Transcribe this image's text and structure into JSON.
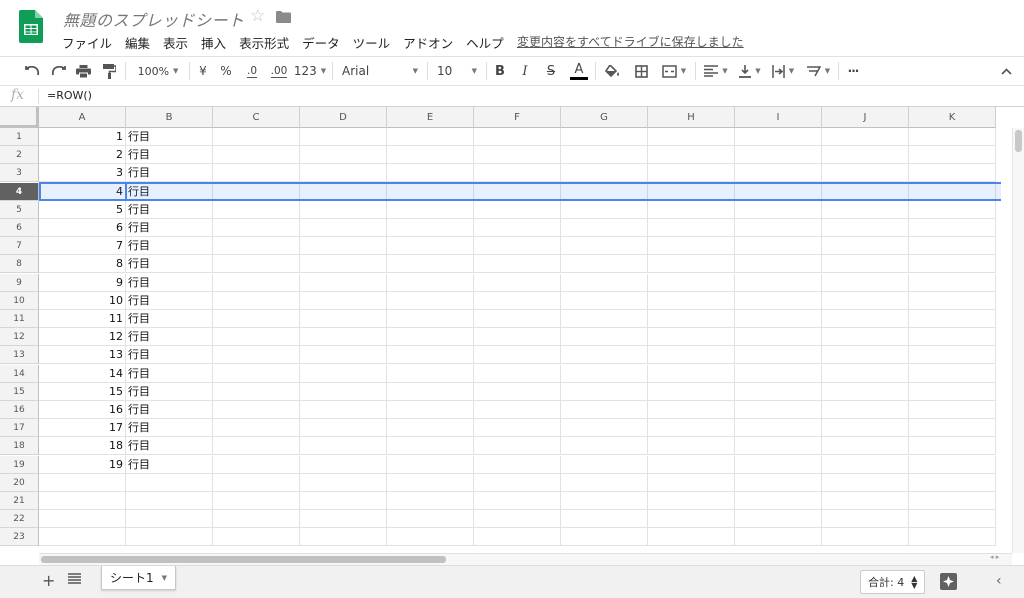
{
  "header": {
    "title": "無題のスプレッドシート",
    "save_status": "変更内容をすべてドライブに保存しました",
    "menu": [
      "ファイル",
      "編集",
      "表示",
      "挿入",
      "表示形式",
      "データ",
      "ツール",
      "アドオン",
      "ヘルプ"
    ]
  },
  "toolbar": {
    "zoom": "100%",
    "currency": "¥",
    "percent": "%",
    "decrease_decimal": ".0",
    "increase_decimal": ".00",
    "more_formats": "123",
    "font": "Arial",
    "font_size": "10",
    "bold": "B",
    "italic": "I",
    "strikethrough": "S",
    "text_color": "A",
    "more": "···"
  },
  "formula_bar": {
    "fx": "fx",
    "value": "=ROW()"
  },
  "grid": {
    "columns": [
      "A",
      "B",
      "C",
      "D",
      "E",
      "F",
      "G",
      "H",
      "I",
      "J",
      "K"
    ],
    "row_numbers": [
      "1",
      "2",
      "3",
      "4",
      "5",
      "6",
      "7",
      "8",
      "9",
      "10",
      "11",
      "12",
      "13",
      "14",
      "15",
      "16",
      "17",
      "18",
      "19",
      "20",
      "21",
      "22",
      "23"
    ],
    "selected_row": 4,
    "rows": [
      {
        "a": "1",
        "b": "行目"
      },
      {
        "a": "2",
        "b": "行目"
      },
      {
        "a": "3",
        "b": "行目"
      },
      {
        "a": "4",
        "b": "行目"
      },
      {
        "a": "5",
        "b": "行目"
      },
      {
        "a": "6",
        "b": "行目"
      },
      {
        "a": "7",
        "b": "行目"
      },
      {
        "a": "8",
        "b": "行目"
      },
      {
        "a": "9",
        "b": "行目"
      },
      {
        "a": "10",
        "b": "行目"
      },
      {
        "a": "11",
        "b": "行目"
      },
      {
        "a": "12",
        "b": "行目"
      },
      {
        "a": "13",
        "b": "行目"
      },
      {
        "a": "14",
        "b": "行目"
      },
      {
        "a": "15",
        "b": "行目"
      },
      {
        "a": "16",
        "b": "行目"
      },
      {
        "a": "17",
        "b": "行目"
      },
      {
        "a": "18",
        "b": "行目"
      },
      {
        "a": "19",
        "b": "行目"
      }
    ]
  },
  "bottom": {
    "sheet_name": "シート1",
    "sum": "合計: 4"
  },
  "colors": {
    "brand_green": "#0f9d58",
    "selection_blue": "#4a86e8",
    "active_row_header": "#616161"
  }
}
